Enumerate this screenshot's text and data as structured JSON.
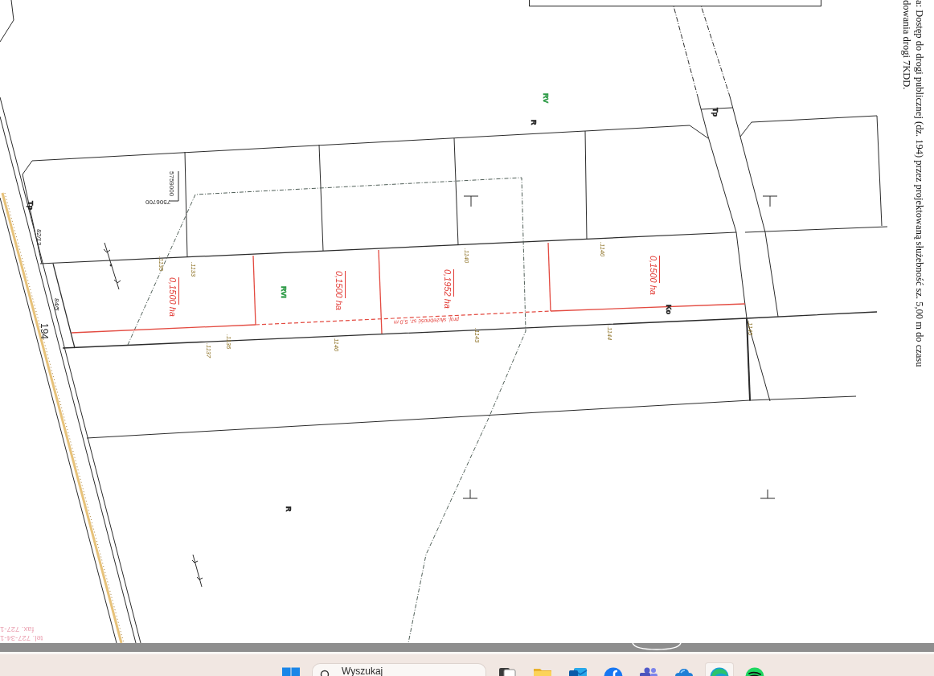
{
  "map": {
    "side_note": [
      "a: Dostęp do drogi publicznej (dz. 194) przez projektowaną służebność sz. 5,00 m do czasu",
      "dowania drogi 7KDD."
    ],
    "parcel_areas": [
      {
        "value": "0,1500",
        "unit": "ha"
      },
      {
        "value": "0,1500",
        "unit": "ha"
      },
      {
        "value": "0,1952",
        "unit": "ha"
      },
      {
        "value": "0,1500",
        "unit": "ha"
      }
    ],
    "easement_label": "proj. służebność sz. 5,0 m",
    "point_numbers": [
      ".1135",
      ".1133",
      ".1137",
      ".1136",
      "1140",
      ".1140",
      ".1143",
      ".1140",
      ".1144",
      ".1145"
    ],
    "land_use_labels": [
      {
        "text": "RV",
        "color": "#2e9b47"
      },
      {
        "text": "Tp",
        "color": "#222222"
      },
      {
        "text": "R",
        "color": "#222222"
      },
      {
        "text": "Tp",
        "color": "#222222"
      },
      {
        "text": "RVI",
        "color": "#2e9b47"
      },
      {
        "text": "Ko",
        "color": "#222222"
      },
      {
        "text": "R",
        "color": "#222222"
      }
    ],
    "parcel_numbers": [
      "82/13",
      "84/5",
      "194"
    ],
    "grid_coordinates": [
      {
        "text": "5759000",
        "kind": "vertical"
      },
      {
        "text": "7506700",
        "kind": "inverted"
      }
    ],
    "faint_text": [
      "fax. 727-1",
      "tel. 727-34-1"
    ]
  },
  "taskbar": {
    "search": {
      "placeholder": "Wyszukaj"
    },
    "apps": [
      {
        "kind": "taskview",
        "selected": false
      },
      {
        "kind": "folder",
        "selected": false
      },
      {
        "kind": "mail",
        "selected": false
      },
      {
        "kind": "social",
        "selected": false
      },
      {
        "kind": "chat",
        "selected": false
      },
      {
        "kind": "cloud",
        "selected": false
      },
      {
        "kind": "browser",
        "selected": true
      },
      {
        "kind": "music",
        "selected": false
      }
    ]
  }
}
